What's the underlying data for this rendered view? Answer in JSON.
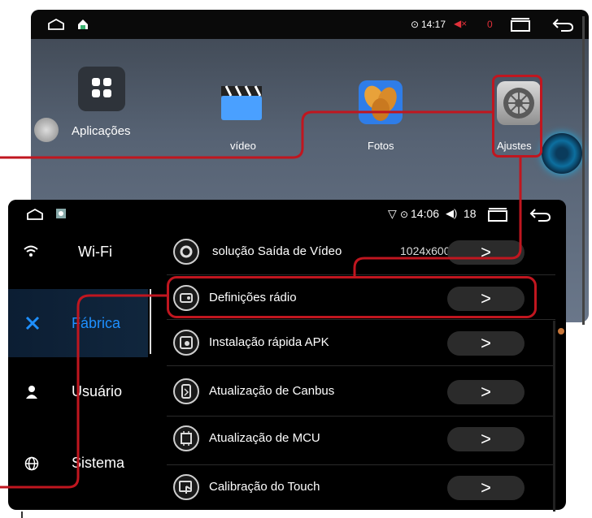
{
  "home": {
    "time": "14:17",
    "red_count": "0",
    "apps": [
      {
        "label": "Aplicações",
        "icon": "grid-icon"
      },
      {
        "label": "vídeo",
        "icon": "clapperboard-icon"
      },
      {
        "label": "Fotos",
        "icon": "photos-icon"
      },
      {
        "label": "Ajustes",
        "icon": "settings-gear-icon"
      }
    ]
  },
  "settings": {
    "time": "14:06",
    "volume": "18",
    "sidebar": [
      {
        "label": "Wi-Fi",
        "icon": "wifi-icon"
      },
      {
        "label": "Fábrica",
        "icon": "tools-icon",
        "active": true
      },
      {
        "label": "Usuário",
        "icon": "user-icon"
      },
      {
        "label": "Sistema",
        "icon": "globe-icon"
      }
    ],
    "rows": [
      {
        "label": "solução Saída de Vídeo",
        "value": "1024x600",
        "icon": "gear-icon"
      },
      {
        "label": "Definições rádio",
        "icon": "radio-icon"
      },
      {
        "label": "Instalação rápida APK",
        "icon": "apk-install-icon"
      },
      {
        "label": "Atualização de Canbus",
        "icon": "canbus-icon"
      },
      {
        "label": "Atualização de MCU",
        "icon": "mcu-chip-icon"
      },
      {
        "label": "Calibração do Touch",
        "icon": "touch-hand-icon"
      }
    ],
    "chevron": ">"
  },
  "colors": {
    "accent": "#1e90ff",
    "highlight": "#c0161f"
  }
}
